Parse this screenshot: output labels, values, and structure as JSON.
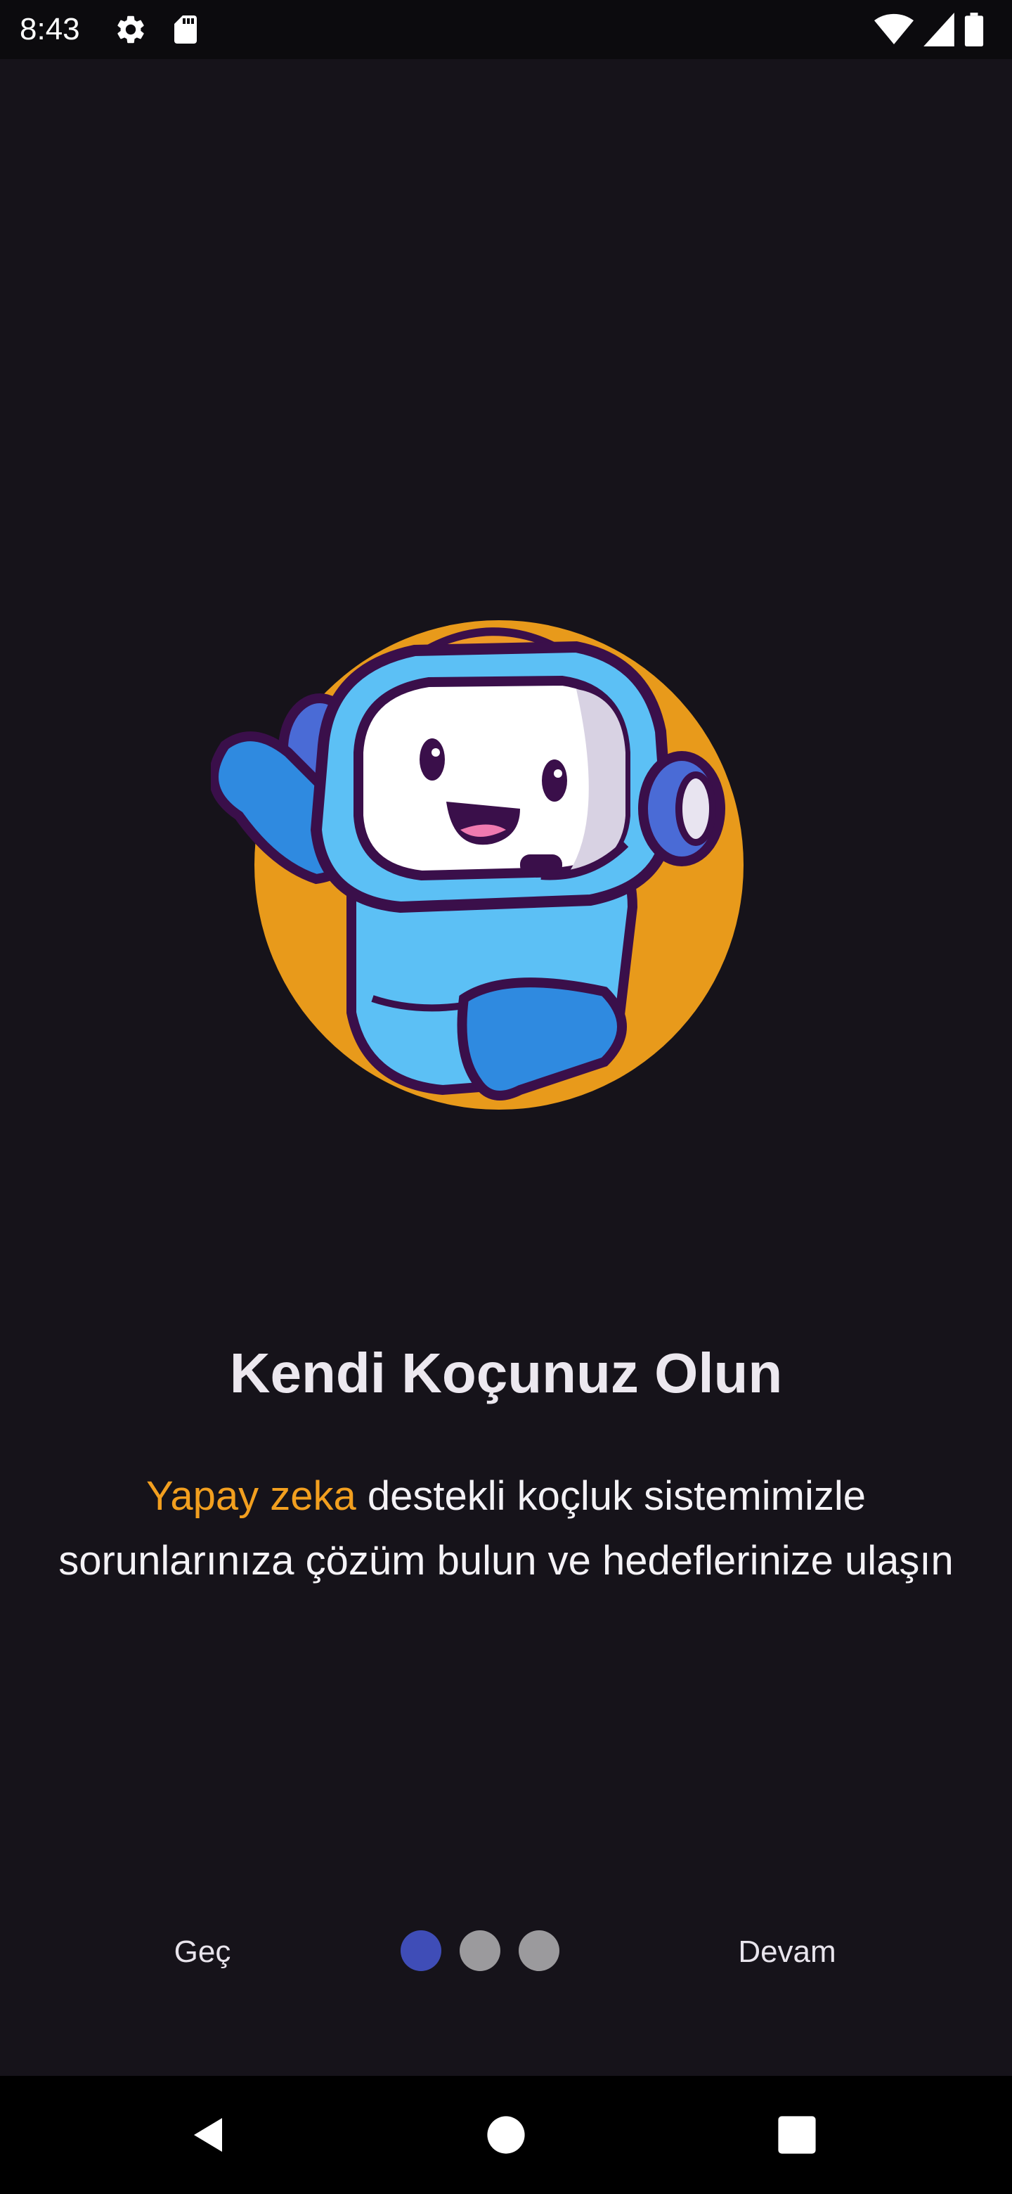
{
  "status_bar": {
    "time": "8:43",
    "left_icons": [
      "gear-icon",
      "sd-card-icon"
    ],
    "right_icons": [
      "wifi-icon",
      "signal-icon",
      "battery-icon"
    ]
  },
  "colors": {
    "background": "#16131a",
    "accent_orange": "#f29f1f",
    "active_dot": "#3f4db7",
    "inactive_dot": "#9b9a9d"
  },
  "onboarding": {
    "illustration": "robot-headset-mascot",
    "title": "Kendi Koçunuz Olun",
    "description_highlight": "Yapay zeka",
    "description_rest": " destekli koçluk sistemimizle sorunlarınıza çözüm bulun ve hedeflerinize ulaşın",
    "skip_label": "Geç",
    "next_label": "Devam",
    "page_count": 3,
    "current_page": 1
  },
  "nav_bar": {
    "icons": [
      "back-icon",
      "home-icon",
      "recents-icon"
    ]
  }
}
